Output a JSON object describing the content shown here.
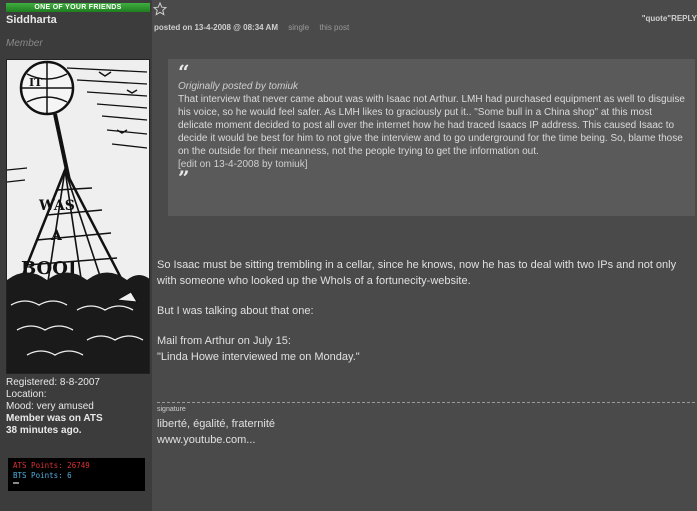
{
  "user": {
    "badge": "ONE OF YOUR FRIENDS",
    "name": "Siddharta",
    "rank": "Member",
    "registered": "Registered: 8-8-2007",
    "location": "Location:",
    "mood": "Mood: very amused",
    "last_seen_line1": "Member was on ATS",
    "last_seen_line2": "38 minutes ago.",
    "avatar_text": "IT WAS A BOOJUM",
    "ats_points": "ATS Points:  26749",
    "bts_points": "BTS Points:  6"
  },
  "post": {
    "date": "posted on 13-4-2008 @ 08:34 AM",
    "single_link": "single",
    "this_post_link": "this post",
    "quote_reply": "\"quote\"REPLY"
  },
  "quote": {
    "open_mark": "“",
    "author": "Originally posted by tomiuk",
    "text": "That interview that never came about was with Isaac not Arthur. LMH had purchased equipment as well to disguise his voice, so he would feel safer. As LMH likes to graciously put it.. \"Some bull in a China shop\" at this most delicate moment decided to post all over the internet how he had traced Isaacs IP address. This caused Isaac to decide it would be best for him to not give the interview and to go underground for the time being. So, blame those on the outside for their meanness, not the people trying to get the information out.",
    "edit": "[edit on 13-4-2008 by tomiuk]",
    "close_mark": "”"
  },
  "body": {
    "para1": "So Isaac must be sitting trembling in a cellar, since he knows, now he has to deal with two IPs and not only with someone who looked up the WhoIs of a fortunecity-website.",
    "para2": "But I was talking about that one:",
    "mail_line1": "Mail from Arthur on July 15:",
    "mail_line2": "\"Linda Howe interviewed me on Monday.\""
  },
  "signature": {
    "label": "signature",
    "line1": "liberté, égalité, fraternité",
    "line2": "www.youtube.com..."
  }
}
